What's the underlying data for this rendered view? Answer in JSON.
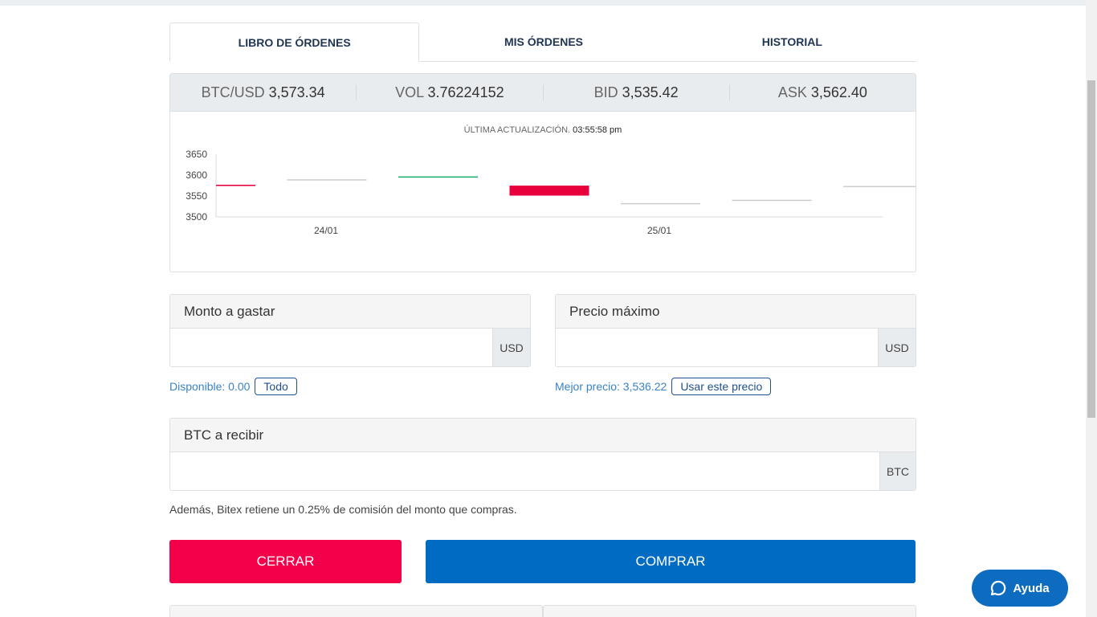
{
  "tabs": [
    {
      "label": "LIBRO DE ÓRDENES",
      "active": true
    },
    {
      "label": "MIS ÓRDENES",
      "active": false
    },
    {
      "label": "HISTORIAL",
      "active": false
    }
  ],
  "ticker": [
    {
      "label": "BTC/USD",
      "value": "3,573.34"
    },
    {
      "label": "VOL",
      "value": "3.76224152"
    },
    {
      "label": "BID",
      "value": "3,535.42"
    },
    {
      "label": "ASK",
      "value": "3,562.40"
    }
  ],
  "updated": {
    "label": "ÚLTIMA ACTUALIZACIÓN.",
    "time": "03:55:58 pm"
  },
  "chart_data": {
    "type": "candlestick",
    "yticks": [
      3650,
      3600,
      3550,
      3500
    ],
    "ylim": [
      3500,
      3650
    ],
    "xticks": [
      "24/01",
      "25/01"
    ],
    "candles": [
      {
        "open": 3577,
        "close": 3574,
        "color": "#e8003d"
      },
      {
        "open": 3590,
        "close": 3590,
        "color": "#cccccc"
      },
      {
        "open": 3594,
        "close": 3597,
        "color": "#1fae6c"
      },
      {
        "open": 3575,
        "close": 3551,
        "color": "#e8003d"
      },
      {
        "open": 3533,
        "close": 3533,
        "color": "#cccccc"
      },
      {
        "open": 3541,
        "close": 3541,
        "color": "#cccccc"
      },
      {
        "open": 3574,
        "close": 3574,
        "color": "#cccccc"
      }
    ]
  },
  "form": {
    "amount": {
      "label": "Monto a gastar",
      "unit": "USD",
      "value": ""
    },
    "price": {
      "label": "Precio máximo",
      "unit": "USD",
      "value": ""
    },
    "btc": {
      "label": "BTC a recibir",
      "unit": "BTC",
      "value": ""
    },
    "available": {
      "text": "Disponible: 0.00",
      "button": "Todo"
    },
    "best_price": {
      "text": "Mejor precio: 3,536.22",
      "button": "Usar este precio"
    },
    "note": "Además, Bitex retiene un 0.25% de comisión del monto que compras."
  },
  "buttons": {
    "close": "CERRAR",
    "buy": "COMPRAR"
  },
  "help": {
    "label": "Ayuda"
  }
}
